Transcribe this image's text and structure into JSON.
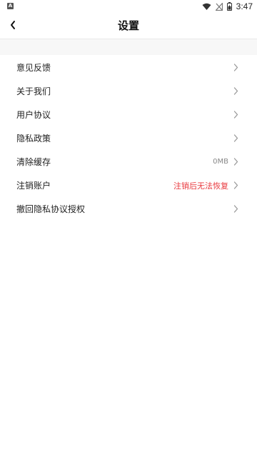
{
  "status_bar": {
    "time": "3:47",
    "left_icon_letter": "A"
  },
  "nav": {
    "title": "设置"
  },
  "menu": {
    "items": [
      {
        "label": "意见反馈",
        "value": ""
      },
      {
        "label": "关于我们",
        "value": ""
      },
      {
        "label": "用户协议",
        "value": ""
      },
      {
        "label": "隐私政策",
        "value": ""
      },
      {
        "label": "清除缓存",
        "value": "0MB"
      },
      {
        "label": "注销账户",
        "value": "注销后无法恢复"
      },
      {
        "label": "撤回隐私协议授权",
        "value": ""
      }
    ]
  },
  "colors": {
    "danger": "#e8383d",
    "muted": "#888888",
    "chevron": "#999999"
  }
}
